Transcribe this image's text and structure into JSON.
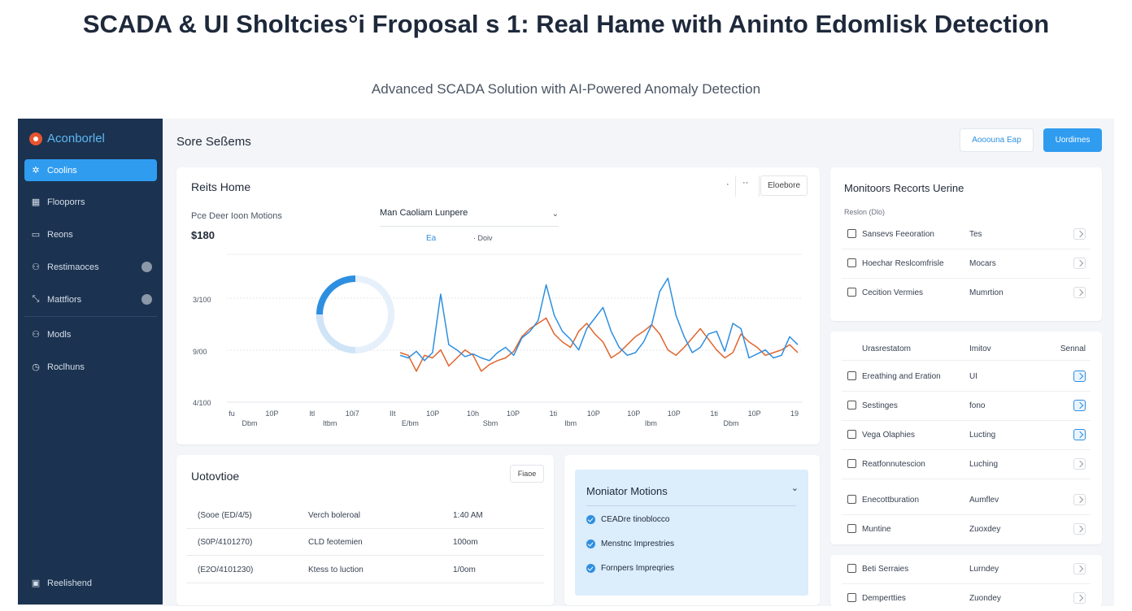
{
  "hero": {
    "title": "SCADA & UI Sholtcies°i Froposal s 1: Real Hame with Aninto Edomlisk Detection",
    "subtitle": "Advanced SCADA Solution with AI-Powered Anomaly Detection"
  },
  "sidebar": {
    "brand": "Aconborlel",
    "items": [
      {
        "label": "Coolins",
        "icon": "sparkle-icon",
        "active": true
      },
      {
        "label": "Flooporrs",
        "icon": "grid-icon"
      },
      {
        "label": "Reons",
        "icon": "image-icon"
      },
      {
        "label": "Restimaoces",
        "icon": "user-icon",
        "badge": true
      },
      {
        "label": "Mattfiors",
        "icon": "trend-icon",
        "badge": true
      },
      {
        "label": "Modls",
        "icon": "user-icon"
      },
      {
        "label": "Roclhuns",
        "icon": "clock-icon"
      }
    ],
    "footer": "Reelishend"
  },
  "header": {
    "title": "Sore Seßems",
    "outline_button": "Aooouna Eap",
    "primary_button": "Uordimes"
  },
  "chart_card": {
    "title": "Reits Home",
    "dot": "·",
    "ellipsis": "··",
    "button": "Eloebore",
    "filter_label": "Pce Deer Ioon Motions",
    "select_value": "Man Caoliam Lunpere",
    "legend_a": "Ea",
    "legend_b": "· Doiv",
    "value": "$180"
  },
  "chart_data": {
    "type": "line",
    "y_tick_labels": [
      "3/100",
      "9/00",
      "4/100"
    ],
    "x_top_labels": [
      "fu",
      "10P",
      "ltl",
      "10i7",
      "IIt",
      "10P",
      "10h",
      "10P",
      "1ti",
      "10P",
      "10P",
      "10P",
      "1ti",
      "10P",
      "19"
    ],
    "x_bottom_labels": [
      "Dbm",
      "Itbm",
      "E/bm",
      "Sbm",
      "Ibm",
      "Ibm",
      "Dbm"
    ],
    "x": [
      0,
      1,
      2,
      3,
      4,
      5,
      6,
      7,
      8,
      9,
      10,
      11,
      12,
      13,
      14,
      15,
      16,
      17,
      18,
      19,
      20,
      21,
      22,
      23,
      24,
      25,
      26,
      27,
      28,
      29,
      30,
      31,
      32,
      33,
      34,
      35,
      36,
      37,
      38,
      39,
      40,
      41,
      42,
      43,
      44,
      45,
      46,
      47,
      48,
      49
    ],
    "series": [
      {
        "values": [
          42,
          40,
          45,
          38,
          44,
          88,
          50,
          46,
          41,
          43,
          40,
          38,
          44,
          48,
          42,
          55,
          60,
          68,
          95,
          72,
          60,
          54,
          46,
          62,
          70,
          78,
          60,
          48,
          42,
          44,
          52,
          65,
          90,
          100,
          72,
          56,
          44,
          48,
          58,
          60,
          45,
          66,
          62,
          40,
          43,
          46,
          40,
          42,
          56,
          50
        ],
        "color": "#2e8fe0"
      },
      {
        "values": [
          44,
          42,
          30,
          42,
          40,
          46,
          34,
          40,
          46,
          42,
          30,
          35,
          38,
          40,
          45,
          56,
          62,
          66,
          70,
          58,
          52,
          48,
          60,
          66,
          58,
          52,
          40,
          44,
          50,
          56,
          60,
          65,
          58,
          46,
          42,
          48,
          55,
          62,
          54,
          46,
          40,
          44,
          58,
          52,
          48,
          42,
          44,
          46,
          50,
          44
        ],
        "color": "#e0642e"
      }
    ],
    "ylim": [
      0,
      110
    ],
    "donut_fraction": 0.28
  },
  "recent": {
    "title": "Uotovtioe",
    "button": "Fiaoe",
    "rows": [
      [
        "(Sooe (ED/4/5)",
        "Verch boleroal",
        "1:40 AM"
      ],
      [
        "(S0P/4101270)",
        "CLD feotemien",
        "100om"
      ],
      [
        "(E2O/4101230)",
        "Ktess to luction",
        "1/0om"
      ]
    ]
  },
  "monitor": {
    "title": "Moniator Motions",
    "items": [
      "CEADre tinoblocco",
      "Menstnc Imprestries",
      "Fornpers Impreqries"
    ]
  },
  "panel1": {
    "title": "Monitoors Recorts Uerine",
    "sub": "Reslon (Dlo)",
    "rows": [
      {
        "name": "Sansevs Feeoration",
        "val": "Tes"
      },
      {
        "name": "Hoechar Reslcomfrisle",
        "val": "Mocars"
      },
      {
        "name": "Cecition Vermies",
        "val": "Mumrtion"
      }
    ]
  },
  "panel2": {
    "head": [
      "Urasrestatom",
      "Imitov",
      "Sennal"
    ],
    "rows": [
      {
        "name": "Ereathing and Eration",
        "val": "UI",
        "on": true
      },
      {
        "name": "Sestinges",
        "val": "fono",
        "on": true
      },
      {
        "name": "Vega Olaphies",
        "val": "Lucting",
        "on": true
      },
      {
        "name": "Reatfonnutescion",
        "val": "Luching",
        "on": false
      },
      {
        "name": "Enecottburation",
        "val": "Aumflev",
        "on": false
      },
      {
        "name": "Muntine",
        "val": "Zuoxdey",
        "on": false
      }
    ]
  },
  "panel3": {
    "rows": [
      {
        "name": "Beti Serraies",
        "val": "Lurndey"
      },
      {
        "name": "Dempertties",
        "val": "Zuondey"
      }
    ]
  }
}
